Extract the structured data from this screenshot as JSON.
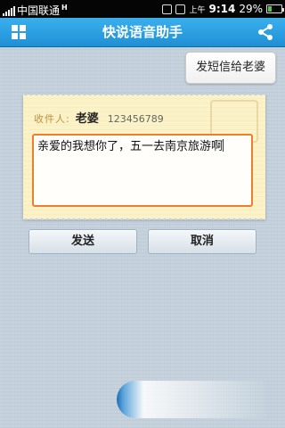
{
  "status_bar": {
    "carrier": "中国联通",
    "network_badge": "H",
    "ampm": "上午",
    "time": "9:14",
    "battery": "29%"
  },
  "title_bar": {
    "title": "快说语音助手",
    "menu_icon": "grid-icon",
    "share_icon": "share-icon"
  },
  "chat": {
    "user_message": "发短信给老婆"
  },
  "sms_card": {
    "recipient_label": "收件人:",
    "recipient_name": "老婆",
    "recipient_number": "123456789",
    "message_body": "亲爱的我想你了，五一去南京旅游啊"
  },
  "actions": {
    "send_label": "发送",
    "cancel_label": "取消"
  },
  "colors": {
    "title_bar": "#2a9fe3",
    "accent_border": "#ef7e2c",
    "card_background": "#fbf2c8"
  }
}
